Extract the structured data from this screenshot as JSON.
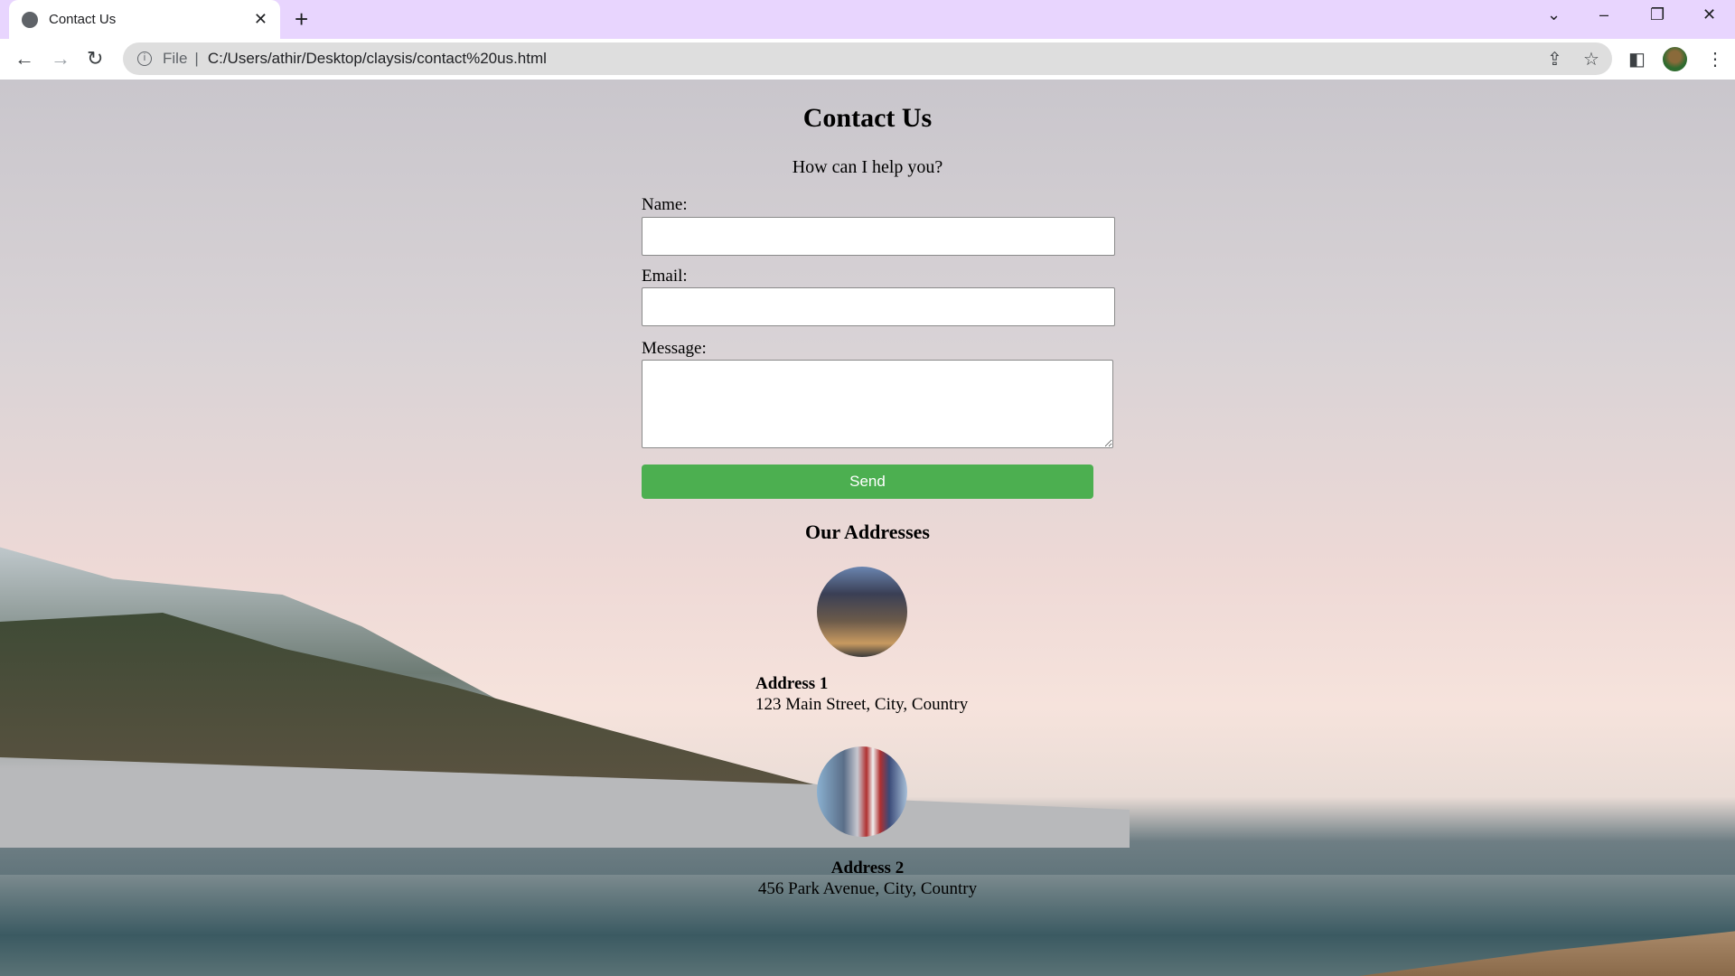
{
  "browser": {
    "tab_title": "Contact Us",
    "new_tab": "+",
    "close": "✕",
    "url_scheme": "File",
    "url": "C:/Users/athir/Desktop/claysis/contact%20us.html"
  },
  "page": {
    "title": "Contact Us",
    "subtitle": "How can I help you?",
    "form": {
      "name_label": "Name:",
      "name_value": "",
      "email_label": "Email:",
      "email_value": "",
      "message_label": "Message:",
      "message_value": "",
      "send_label": "Send",
      "send_color": "#4caf50"
    },
    "addresses_title": "Our Addresses",
    "addresses": [
      {
        "title": "Address 1",
        "text": "123 Main Street, City, Country",
        "image": "office-building"
      },
      {
        "title": "Address 2",
        "text": "456 Park Avenue, City, Country",
        "image": "american-flag-building"
      }
    ]
  }
}
